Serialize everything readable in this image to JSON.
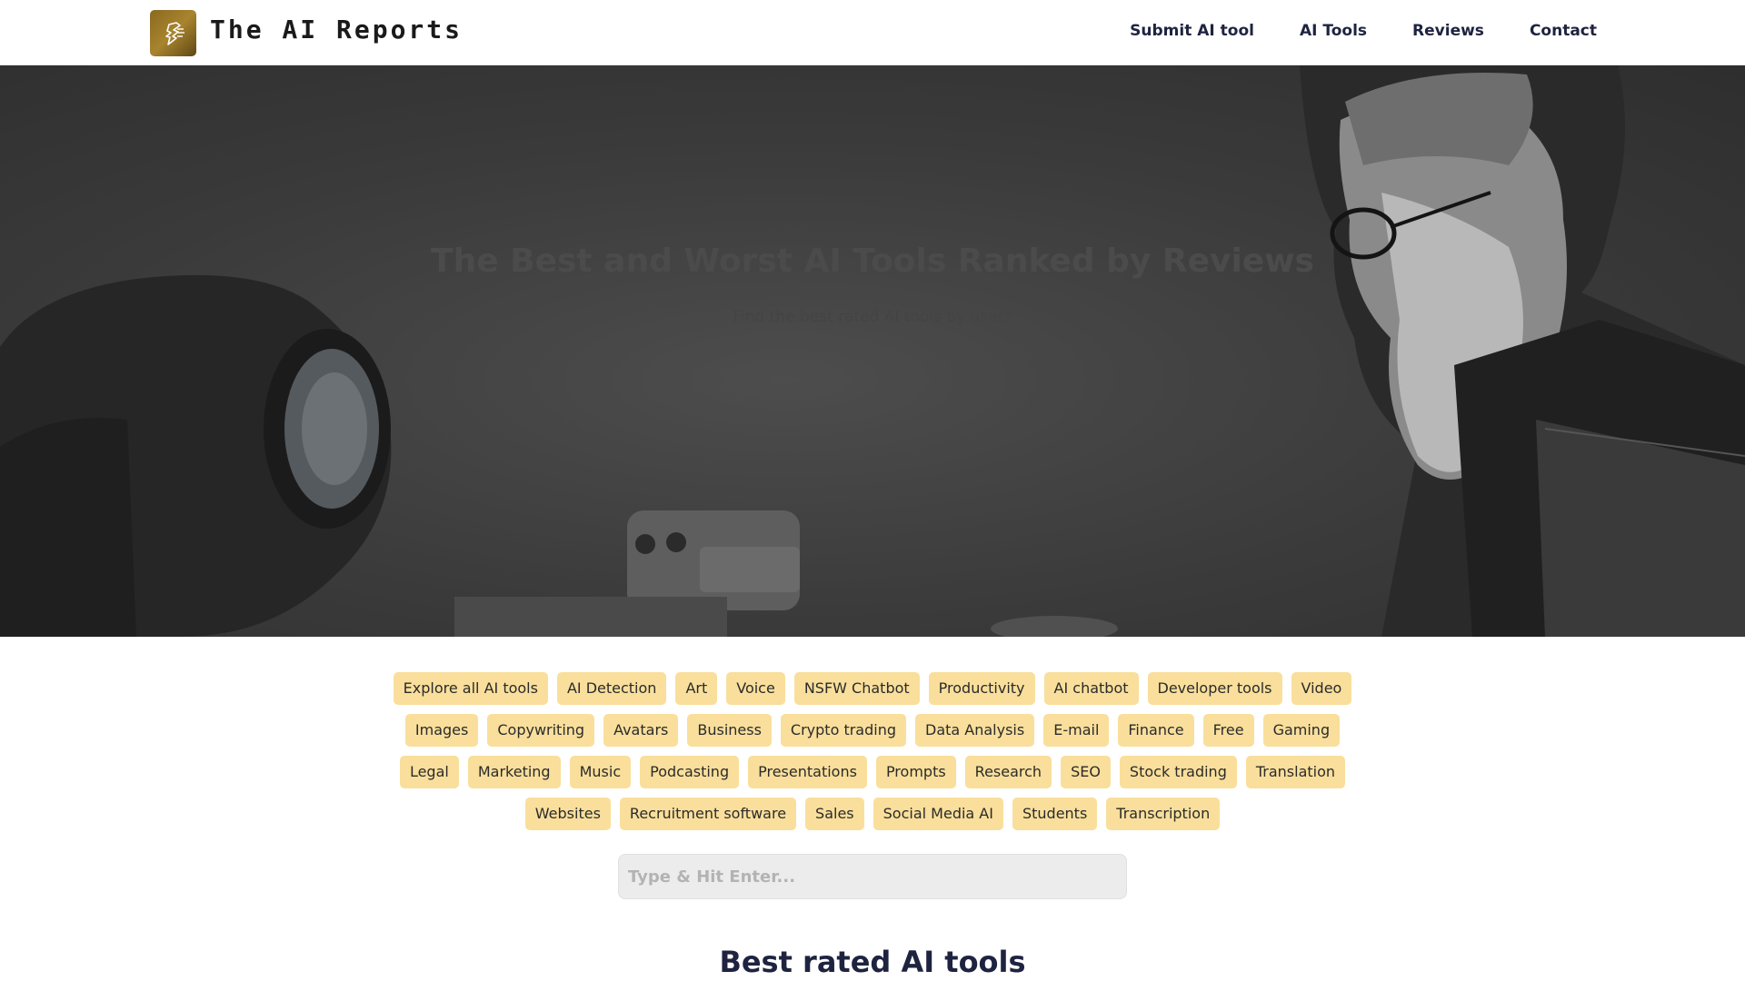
{
  "header": {
    "site_title": "The AI Reports",
    "nav": [
      {
        "label": "Submit AI tool"
      },
      {
        "label": "AI Tools"
      },
      {
        "label": "Reviews"
      },
      {
        "label": "Contact"
      }
    ]
  },
  "hero": {
    "title": "The Best and Worst AI Tools Ranked by Reviews",
    "subtitle": "Find the best rated AI tools by users"
  },
  "tags": [
    "Explore all AI tools",
    "AI Detection",
    "Art",
    "Voice",
    "NSFW Chatbot",
    "Productivity",
    "AI chatbot",
    "Developer tools",
    "Video",
    "Images",
    "Copywriting",
    "Avatars",
    "Business",
    "Crypto trading",
    "Data Analysis",
    "E-mail",
    "Finance",
    "Free",
    "Gaming",
    "Legal",
    "Marketing",
    "Music",
    "Podcasting",
    "Presentations",
    "Prompts",
    "Research",
    "SEO",
    "Stock trading",
    "Translation",
    "Websites",
    "Recruitment software",
    "Sales",
    "Social Media AI",
    "Students",
    "Transcription"
  ],
  "search": {
    "placeholder": "Type & Hit Enter..."
  },
  "main": {
    "section_title": "Best rated AI tools"
  },
  "colors": {
    "tag_bg": "#f9df9b",
    "nav_text": "#1e2340",
    "logo_gold": "#a8842f"
  }
}
